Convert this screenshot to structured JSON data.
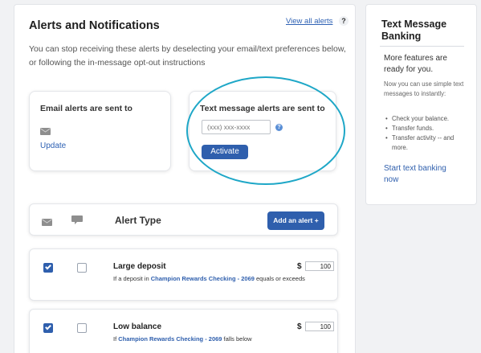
{
  "main": {
    "title": "Alerts and Notifications",
    "view_all_label": "View all alerts",
    "help_label": "?",
    "intro": "You can stop receiving these alerts by deselecting your email/text preferences below, or following the in-message opt-out instructions"
  },
  "email_card": {
    "title": "Email alerts are sent to",
    "icon": "envelope-icon",
    "update_label": "Update"
  },
  "text_card": {
    "title": "Text message alerts are sent to",
    "phone_placeholder": "(xxx) xxx-xxxx",
    "info_label": "?",
    "activate_label": "Activate",
    "highlight_color": "#1ea7c7"
  },
  "alerts_header": {
    "email_icon": "envelope-icon",
    "text_icon": "chat-bubble-icon",
    "title": "Alert Type",
    "add_label": "Add an alert +"
  },
  "alerts": [
    {
      "title": "Large deposit",
      "desc_prefix": "If a deposit in ",
      "account": "Champion Rewards Checking - 2069",
      "desc_suffix": " equals or exceeds",
      "email_checked": true,
      "text_checked": false,
      "currency": "$",
      "amount": "100"
    },
    {
      "title": "Low balance",
      "desc_prefix": "If ",
      "account": "Champion Rewards Checking - 2069",
      "desc_suffix": " falls below",
      "email_checked": true,
      "text_checked": false,
      "currency": "$",
      "amount": "100"
    }
  ],
  "sidebar": {
    "title": "Text Message Banking",
    "lead": "More features are ready for you.",
    "sub": "Now you can use simple text messages to instantly:",
    "items": [
      "Check your balance.",
      "Transfer funds.",
      "Transfer activity -- and more."
    ],
    "link": "Start text banking now"
  },
  "colors": {
    "primary_button": "#2f5fad",
    "link": "#2f62b4",
    "background": "#f1f2f4"
  }
}
